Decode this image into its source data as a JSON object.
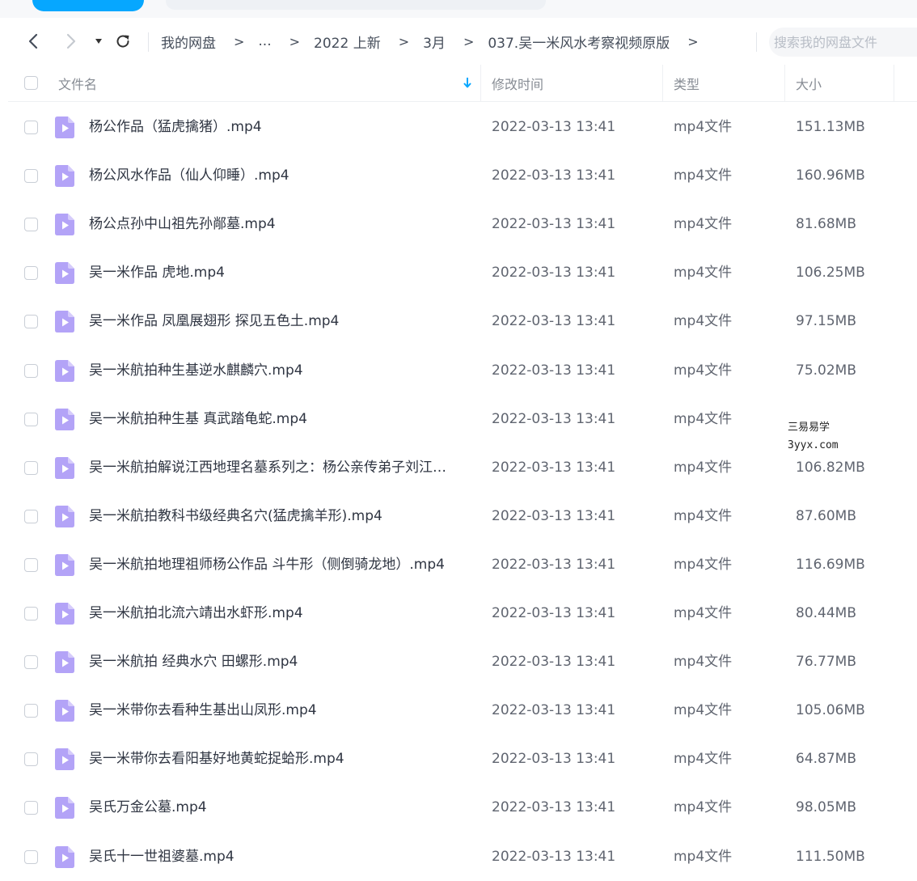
{
  "nav": {
    "back_icon": "chevron-left-icon",
    "forward_icon": "chevron-right-icon",
    "history_icon": "caret-down-icon",
    "refresh_icon": "refresh-icon"
  },
  "breadcrumb": {
    "items": [
      "我的网盘",
      "...",
      "2022 上新",
      "3月",
      "037.吴一米风水考察视频原版"
    ],
    "separator": ">"
  },
  "search": {
    "placeholder": "搜索我的网盘文件"
  },
  "header": {
    "name": "文件名",
    "modified": "修改时间",
    "type": "类型",
    "size": "大小"
  },
  "files": [
    {
      "name": "杨公作品（猛虎擒猪）.mp4",
      "time": "2022-03-13 13:41",
      "type": "mp4文件",
      "size": "151.13MB"
    },
    {
      "name": "杨公风水作品（仙人仰睡）.mp4",
      "time": "2022-03-13 13:41",
      "type": "mp4文件",
      "size": "160.96MB"
    },
    {
      "name": "杨公点孙中山祖先孙䣊墓.mp4",
      "time": "2022-03-13 13:41",
      "type": "mp4文件",
      "size": "81.68MB"
    },
    {
      "name": "吴一米作品 虎地.mp4",
      "time": "2022-03-13 13:41",
      "type": "mp4文件",
      "size": "106.25MB"
    },
    {
      "name": "吴一米作品 凤凰展翅形 探见五色土.mp4",
      "time": "2022-03-13 13:41",
      "type": "mp4文件",
      "size": "97.15MB"
    },
    {
      "name": "吴一米航拍种生基逆水麒麟穴.mp4",
      "time": "2022-03-13 13:41",
      "type": "mp4文件",
      "size": "75.02MB"
    },
    {
      "name": "吴一米航拍种生基 真武踏龟蛇.mp4",
      "time": "2022-03-13 13:41",
      "type": "mp4文件",
      "size": ""
    },
    {
      "name": "吴一米航拍解说江西地理名墓系列之：杨公亲传弟子刘江…",
      "time": "2022-03-13 13:41",
      "type": "mp4文件",
      "size": "106.82MB"
    },
    {
      "name": "吴一米航拍教科书级经典名穴(猛虎擒羊形).mp4",
      "time": "2022-03-13 13:41",
      "type": "mp4文件",
      "size": "87.60MB"
    },
    {
      "name": "吴一米航拍地理祖师杨公作品 斗牛形（侧倒骑龙地）.mp4",
      "time": "2022-03-13 13:41",
      "type": "mp4文件",
      "size": "116.69MB"
    },
    {
      "name": "吴一米航拍北流六靖出水虾形.mp4",
      "time": "2022-03-13 13:41",
      "type": "mp4文件",
      "size": "80.44MB"
    },
    {
      "name": "吴一米航拍 经典水穴 田螺形.mp4",
      "time": "2022-03-13 13:41",
      "type": "mp4文件",
      "size": "76.77MB"
    },
    {
      "name": "吴一米带你去看种生基出山凤形.mp4",
      "time": "2022-03-13 13:41",
      "type": "mp4文件",
      "size": "105.06MB"
    },
    {
      "name": "吴一米带你去看阳基好地黄蛇捉蛤形.mp4",
      "time": "2022-03-13 13:41",
      "type": "mp4文件",
      "size": "64.87MB"
    },
    {
      "name": "吴氏万金公墓.mp4",
      "time": "2022-03-13 13:41",
      "type": "mp4文件",
      "size": "98.05MB"
    },
    {
      "name": "吴氏十一世祖婆墓.mp4",
      "time": "2022-03-13 13:41",
      "type": "mp4文件",
      "size": "111.50MB"
    }
  ],
  "watermark": {
    "line1": "三易易学",
    "line2": "3yyx.com"
  },
  "colors": {
    "accent": "#06a7ff",
    "video_icon": "#b3a3f7"
  }
}
